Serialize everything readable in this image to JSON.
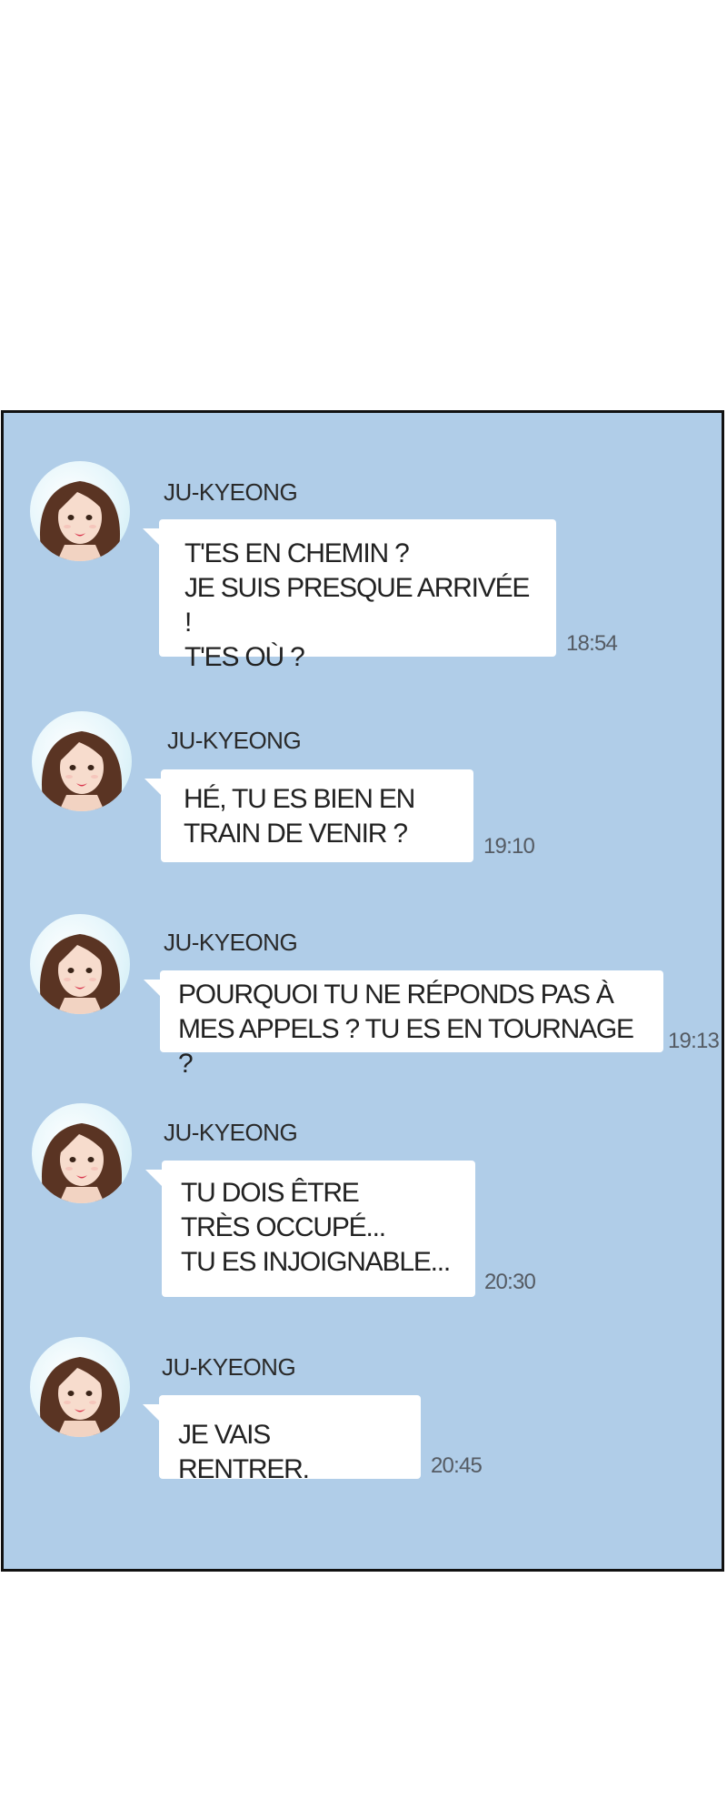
{
  "chat": {
    "messages": [
      {
        "sender": "JU-KYEONG",
        "text": "T'ES EN CHEMIN ?\nJE SUIS PRESQUE ARRIVÉE !\nT'ES OÙ ?",
        "time": "18:54"
      },
      {
        "sender": "JU-KYEONG",
        "text": "HÉ, TU ES BIEN EN\nTRAIN DE VENIR ?",
        "time": "19:10"
      },
      {
        "sender": "JU-KYEONG",
        "text": "POURQUOI TU NE RÉPONDS PAS À\nMES APPELS ? TU ES EN TOURNAGE ?",
        "time": "19:13"
      },
      {
        "sender": "JU-KYEONG",
        "text": "TU DOIS ÊTRE\nTRÈS OCCUPÉ...\nTU ES INJOIGNABLE...",
        "time": "20:30"
      },
      {
        "sender": "JU-KYEONG",
        "text": "JE VAIS RENTRER.",
        "time": "20:45"
      }
    ]
  },
  "colors": {
    "chat_background": "#b0cde8",
    "bubble": "#ffffff",
    "panel_border": "#111111",
    "timestamp": "#555b63"
  },
  "icons": {
    "avatar": "profile-avatar-woman"
  }
}
